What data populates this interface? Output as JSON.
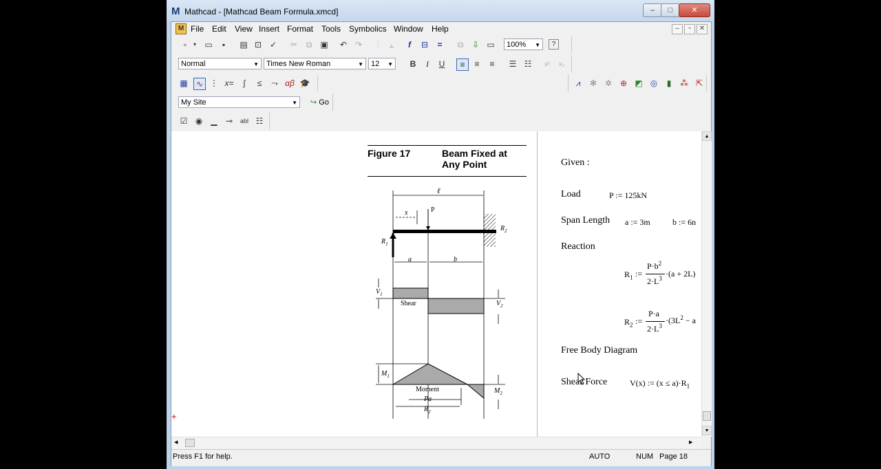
{
  "window": {
    "title": "Mathcad - [Mathcad Beam Formula.xmcd]",
    "controls": {
      "minimize": "–",
      "maximize": "□",
      "close": "✕"
    }
  },
  "menu": [
    "File",
    "Edit",
    "View",
    "Insert",
    "Format",
    "Tools",
    "Symbolics",
    "Window",
    "Help"
  ],
  "mdi_controls": {
    "minimize": "–",
    "restore": "▫",
    "close": "✕"
  },
  "toolbar_standard": {
    "zoom": "100%"
  },
  "toolbar_formatting": {
    "style": "Normal",
    "font": "Times New Roman",
    "size": "12",
    "bold": "B",
    "italic": "I",
    "underline": "U"
  },
  "toolbar_resources": {
    "site": "My Site",
    "go": "Go"
  },
  "figure": {
    "number": "Figure 17",
    "title_line1": "Beam Fixed at",
    "title_line2": "Any Point",
    "labels": {
      "l": "ℓ",
      "x": "x",
      "P": "P",
      "R1": "R",
      "R1_sub": "1",
      "R2": "R",
      "R2_sub": "2",
      "a": "a",
      "b": "b",
      "V1": "V",
      "V1_sub": "1",
      "V2": "V",
      "V2_sub": "2",
      "shear": "Shear",
      "M1": "M",
      "M1_sub": "1",
      "M2": "M",
      "M2_sub": "2",
      "moment": "Moment",
      "pa_num": "Pa",
      "pa_den": "R",
      "pa_den_sub": "2"
    }
  },
  "worksheet": {
    "given": "Given :",
    "load_label": "Load",
    "load_expr": "P := 125kN",
    "span_label": "Span Length",
    "span_a": "a := 3m",
    "span_b": "b := 6n",
    "reaction_label": "Reaction",
    "r1_lhs": "R",
    "r1_sub": "1",
    "r1_assign": ":=",
    "r1_num": "P·b",
    "r1_num_sup": "2",
    "r1_den": "2·L",
    "r1_den_sup": "3",
    "r1_tail": "·(a + 2L)",
    "r2_lhs": "R",
    "r2_sub": "2",
    "r2_assign": ":=",
    "r2_num": "P·a",
    "r2_den": "2·L",
    "r2_den_sup": "3",
    "r2_tail": "·(3L",
    "r2_tail_sup": "2",
    "r2_tail2": " − a",
    "fbd_label": "Free Body Diagram",
    "shear_label": "Shear Force",
    "shear_expr": "V(x) := (x ≤ a)·R",
    "shear_sub": "1"
  },
  "status": {
    "help": "Press F1 for help.",
    "mode": "AUTO",
    "num": "NUM",
    "page": "Page 18"
  },
  "colors": {
    "window_frame": "#bcd3ea",
    "close_button": "#c84b3c",
    "region_marker": "#cc0000"
  }
}
